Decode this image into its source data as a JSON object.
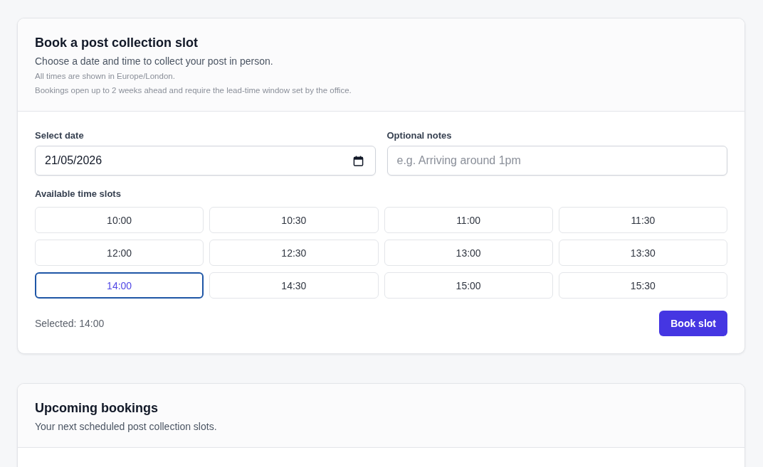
{
  "booking_card": {
    "title": "Book a post collection slot",
    "subtitle": "Choose a date and time to collect your post in person.",
    "notes": [
      "All times are shown in Europe/London.",
      "Bookings open up to 2 weeks ahead and require the lead-time window set by the office."
    ],
    "date_field": {
      "label": "Select date",
      "value": "21/05/2026"
    },
    "notes_field": {
      "label": "Optional notes",
      "placeholder": "e.g. Arriving around 1pm"
    },
    "slots_label": "Available time slots",
    "slots": [
      {
        "label": "10:00",
        "selected": false
      },
      {
        "label": "10:30",
        "selected": false
      },
      {
        "label": "11:00",
        "selected": false
      },
      {
        "label": "11:30",
        "selected": false
      },
      {
        "label": "12:00",
        "selected": false
      },
      {
        "label": "12:30",
        "selected": false
      },
      {
        "label": "13:00",
        "selected": false
      },
      {
        "label": "13:30",
        "selected": false
      },
      {
        "label": "14:00",
        "selected": true
      },
      {
        "label": "14:30",
        "selected": false
      },
      {
        "label": "15:00",
        "selected": false
      },
      {
        "label": "15:30",
        "selected": false
      }
    ],
    "selected_text": "Selected: 14:00",
    "submit_button": "Book slot"
  },
  "upcoming_card": {
    "title": "Upcoming bookings",
    "subtitle": "Your next scheduled post collection slots."
  }
}
